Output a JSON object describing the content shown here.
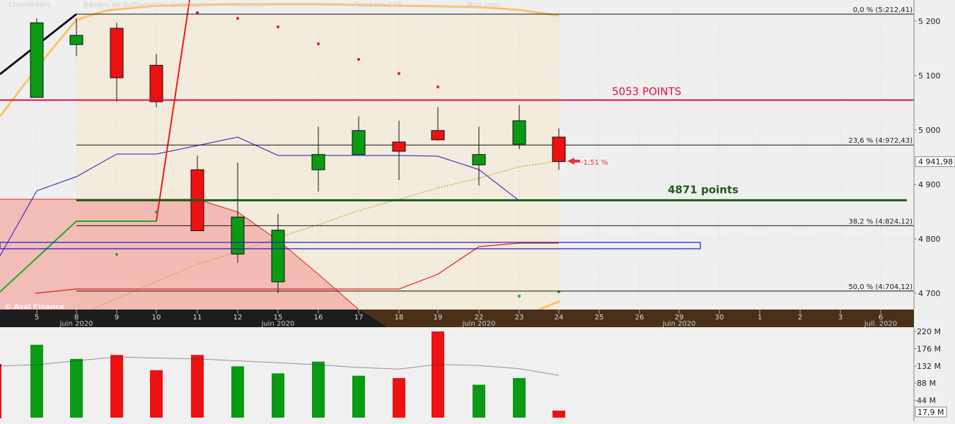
{
  "legend": {
    "items": [
      {
        "label": "Chandeliers",
        "color": "#009900"
      },
      {
        "label": "Bandes de Bollinger(20, 2, Clôture)",
        "color": "#ffcc66"
      },
      {
        "label": "Ichimoku",
        "color": "#e00000"
      },
      {
        "label": "Parabolic SAR",
        "color": "#e00000"
      },
      {
        "label": "Moy. mob.",
        "color": "#009900"
      }
    ]
  },
  "watermark": "© Aval Finance",
  "annotations": {
    "resistance": {
      "label": "5053 POINTS",
      "value": 5055,
      "color": "#dd1144"
    },
    "support": {
      "label": "4871 points",
      "value": 4871,
      "color": "#1a5c1a"
    },
    "change_badge": "-1,51 %",
    "last_price": "4 941,98",
    "last_volume": "17,9 M"
  },
  "chart_data": [
    {
      "type": "candlestick",
      "y_ticks": [
        "5 200",
        "5 100",
        "5 000",
        "4 900",
        "4 800",
        "4 700"
      ],
      "y_tick_values": [
        5200,
        5100,
        5000,
        4900,
        4800,
        4700
      ],
      "ylim": [
        4685,
        5225
      ],
      "x_ticks": [
        "5",
        "8",
        "9",
        "10",
        "11",
        "12",
        "15",
        "16",
        "17",
        "18",
        "19",
        "22",
        "23",
        "24",
        "25",
        "26",
        "29",
        "30",
        "1",
        "2",
        "3",
        "6"
      ],
      "month_labels": [
        {
          "after": "8",
          "text": "juin 2020"
        },
        {
          "after": "15",
          "text": "juin 2020"
        },
        {
          "after": "22",
          "text": "juin 2020"
        },
        {
          "after": "29",
          "text": "juin 2020"
        },
        {
          "after": "6",
          "text": "juil. 2020"
        }
      ],
      "fibonacci": [
        {
          "label": "0,0 % (5:212,41)",
          "value": 5212.41
        },
        {
          "label": "23,6 % (4:972,43)",
          "value": 4972.43
        },
        {
          "label": "38,2 % (4:824,12)",
          "value": 4824.12
        },
        {
          "label": "50,0 % (4:704,12)",
          "value": 4704.12
        }
      ],
      "candles": [
        {
          "date": "5",
          "open": 5060,
          "high": 5205,
          "low": 5060,
          "close": 5197
        },
        {
          "date": "8",
          "open": 5157,
          "high": 5205,
          "low": 5136,
          "close": 5174
        },
        {
          "date": "9",
          "open": 5187,
          "high": 5197,
          "low": 5052,
          "close": 5096
        },
        {
          "date": "10",
          "open": 5119,
          "high": 5140,
          "low": 5042,
          "close": 5052
        },
        {
          "date": "11",
          "open": 4927,
          "high": 4953,
          "low": 4815,
          "close": 4815
        },
        {
          "date": "12",
          "open": 4772,
          "high": 4940,
          "low": 4756,
          "close": 4840
        },
        {
          "date": "15",
          "open": 4721,
          "high": 4846,
          "low": 4700,
          "close": 4816
        },
        {
          "date": "16",
          "open": 4927,
          "high": 5006,
          "low": 4887,
          "close": 4955
        },
        {
          "date": "17",
          "open": 4955,
          "high": 5025,
          "low": 4955,
          "close": 4999
        },
        {
          "date": "18",
          "open": 4978,
          "high": 5017,
          "low": 4908,
          "close": 4961
        },
        {
          "date": "19",
          "open": 4999,
          "high": 5042,
          "low": 4980,
          "close": 4982
        },
        {
          "date": "22",
          "open": 4936,
          "high": 5006,
          "low": 4898,
          "close": 4955
        },
        {
          "date": "23",
          "open": 4974,
          "high": 5046,
          "low": 4965,
          "close": 5017
        },
        {
          "date": "24",
          "open": 4987,
          "high": 5003,
          "low": 4927,
          "close": 4942
        }
      ]
    },
    {
      "type": "bar",
      "y_ticks": [
        "220 M",
        "176 M",
        "132 M",
        "88 M",
        "44 M"
      ],
      "y_tick_values": [
        220,
        176,
        132,
        88,
        44
      ],
      "ylim": [
        0,
        225
      ],
      "categories": [
        "5",
        "8",
        "9",
        "10",
        "11",
        "12",
        "15",
        "16",
        "17",
        "18",
        "19",
        "22",
        "23",
        "24"
      ],
      "values": [
        186,
        150,
        160,
        121,
        160,
        131,
        113,
        143,
        107,
        101,
        220,
        84,
        101,
        17.9
      ],
      "moving_average": [
        135,
        145,
        155,
        152,
        150,
        145,
        140,
        135,
        128,
        124,
        136,
        133,
        125,
        108
      ]
    }
  ]
}
